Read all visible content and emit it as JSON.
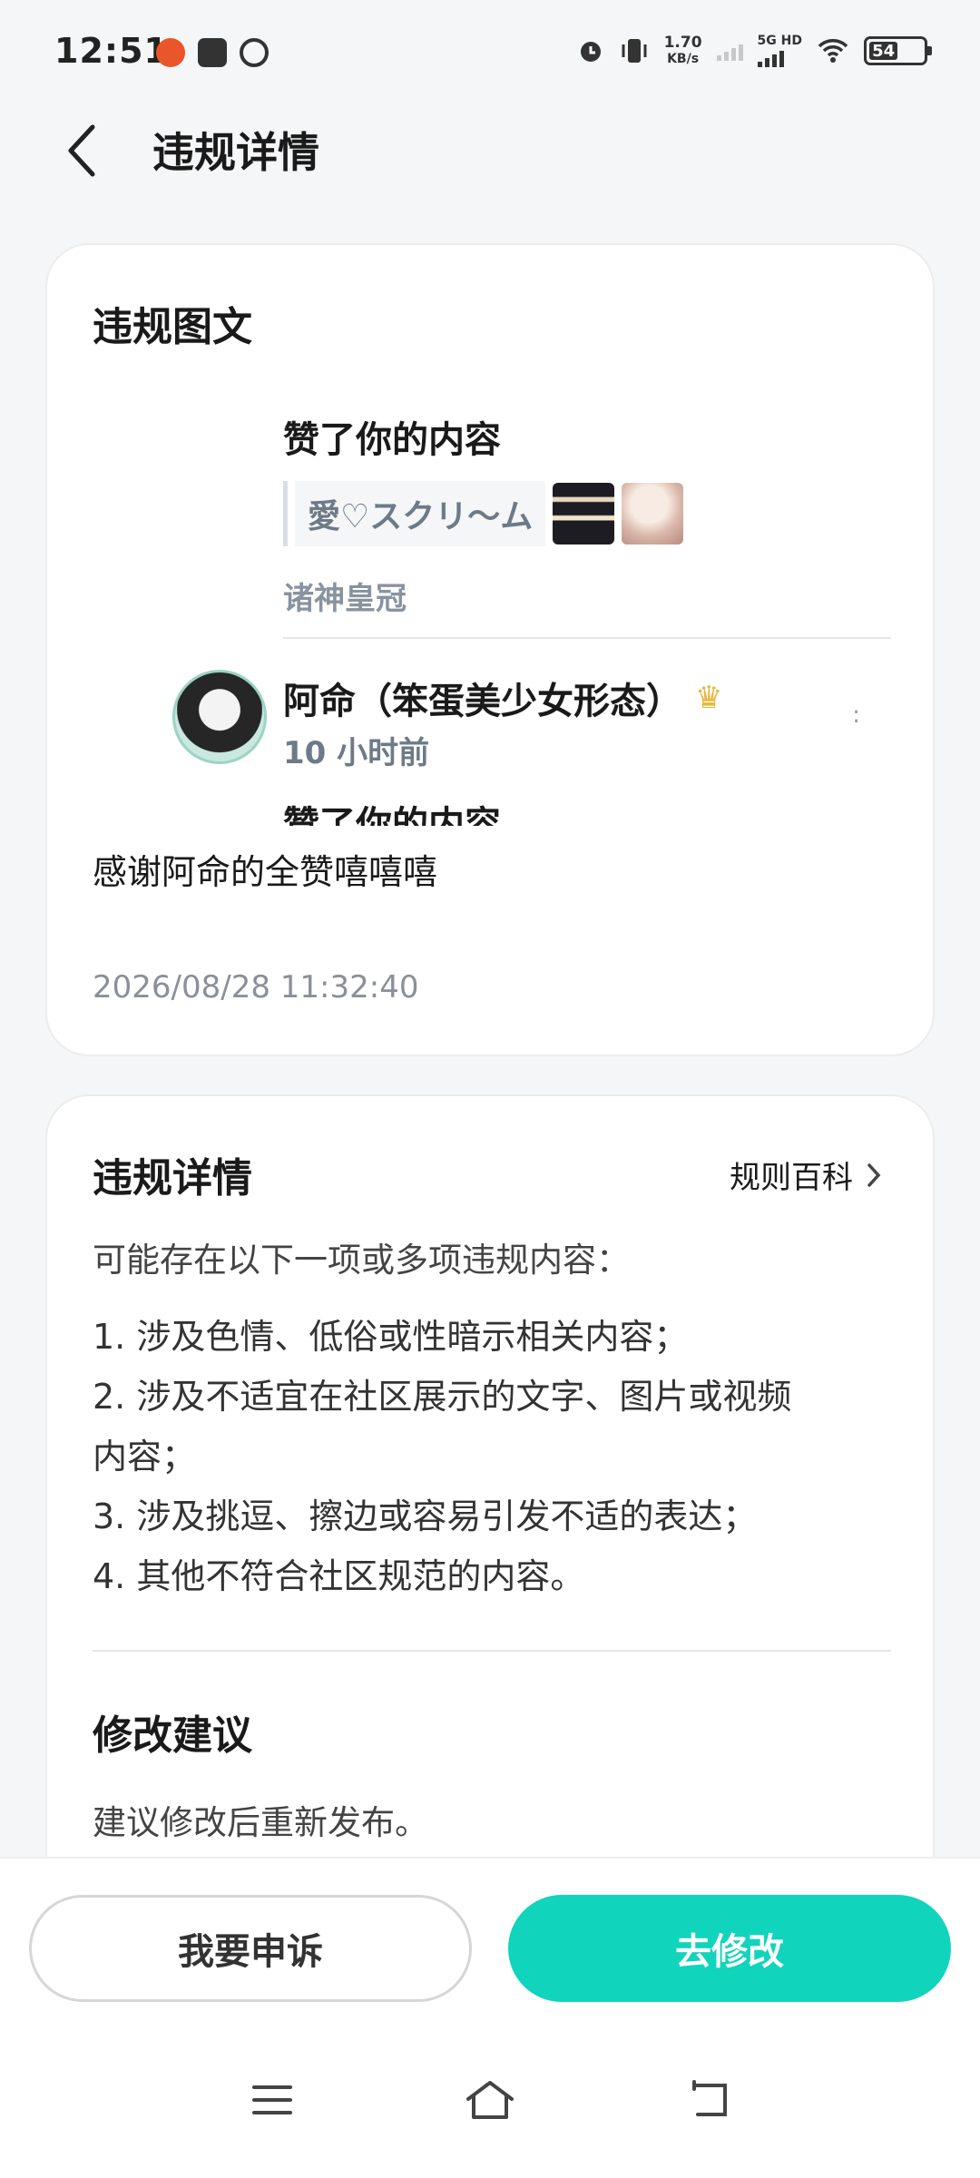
{
  "status_bar": {
    "time": "12:51",
    "net_speed": "1.70",
    "net_unit": "KB/s",
    "sim_label": "5G HD",
    "battery": "54"
  },
  "header": {
    "title": "违规详情",
    "back_icon": "chevron-left-icon"
  },
  "card1": {
    "title": "违规图文",
    "screenshot": {
      "liked_text": "赞了你的内容",
      "quote_text": "愛♡スクリ～ム",
      "source": "诸神皇冠",
      "user_name": "阿命（笨蛋美少女形态）",
      "user_time": "10 小时前",
      "cut_bottom": "赞了你的内容"
    },
    "post_text": "感谢阿命的全赞嘻嘻嘻",
    "post_time": "2026/08/28 11:32:40"
  },
  "card2": {
    "title": "违规详情",
    "rule_link": "规则百科",
    "intro": "可能存在以下一项或多项违规内容：",
    "items": [
      "1. 涉及色情、低俗或性暗示相关内容；",
      "2. 涉及不适宜在社区展示的文字、图片或视频",
      "内容；",
      "3. 涉及挑逗、擦边或容易引发不适的表达；",
      "4. 其他不符合社区规范的内容。"
    ],
    "suggestion_title": "修改建议",
    "suggestion_text": "建议修改后重新发布。"
  },
  "actions": {
    "appeal_label": "我要申诉",
    "edit_label": "去修改"
  },
  "colors": {
    "accent": "#11d4bc",
    "background": "#f5f6f7"
  }
}
